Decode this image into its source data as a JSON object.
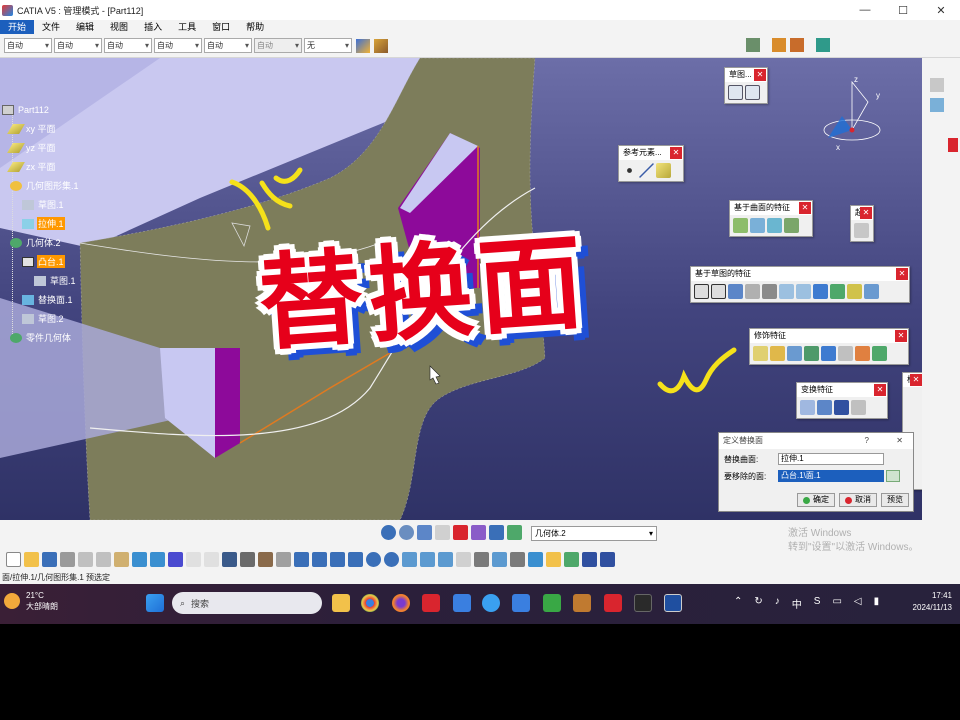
{
  "window": {
    "title": "CATIA V5 : 管理模式 - [Part112]",
    "min": "—",
    "max": "☐",
    "close": "✕"
  },
  "menu": [
    "开始",
    "文件",
    "编辑",
    "视图",
    "插入",
    "工具",
    "窗口",
    "帮助"
  ],
  "propbar": {
    "combo1": "自动",
    "combo2": "自动",
    "combo3": "自动",
    "combo4": "自动",
    "combo5": "自动",
    "combo6": "自动",
    "combo7": "无"
  },
  "tree": {
    "root": "Part112",
    "items": [
      {
        "label": "xy 平面"
      },
      {
        "label": "yz 平面"
      },
      {
        "label": "zx 平面"
      },
      {
        "label": "几何图形集.1"
      },
      {
        "label": "草图.1"
      },
      {
        "label": "拉伸.1"
      },
      {
        "label": "几何体.2"
      },
      {
        "label": "凸台.1"
      },
      {
        "label": "草图.1"
      },
      {
        "label": "替换面.1"
      },
      {
        "label": "草图.2"
      },
      {
        "label": "零件几何体"
      }
    ]
  },
  "overlay_title": "替换面",
  "toolbars": {
    "sketch": "草图...",
    "reference": "参考元素...",
    "surface_based": "基于曲面的特征",
    "sketch_based": "基于草图的特征",
    "dress_up": "修饰特征",
    "transform": "变换特征",
    "partial1": "起",
    "partial2": "标"
  },
  "dialog": {
    "title": "定义替换面",
    "help": "?",
    "close": "✕",
    "replace_label": "替换曲面:",
    "replace_value": "拉伸.1",
    "remove_label": "要移除的面:",
    "remove_value": "凸台.1\\面.1",
    "ok": "确定",
    "cancel": "取消",
    "preview": "预览"
  },
  "body_combo": "几何体.2",
  "status_text": "面/拉伸.1/几何图形集.1 预选定",
  "watermark": {
    "line1": "激活 Windows",
    "line2": "转到\"设置\"以激活 Windows。"
  },
  "taskbar": {
    "temp": "21°C",
    "weather": "大部晴朗",
    "search": "搜索",
    "time": "17:41",
    "date": "2024/11/13",
    "ime": "中"
  },
  "compass_labels": {
    "x": "x",
    "y": "y",
    "z": "z"
  }
}
